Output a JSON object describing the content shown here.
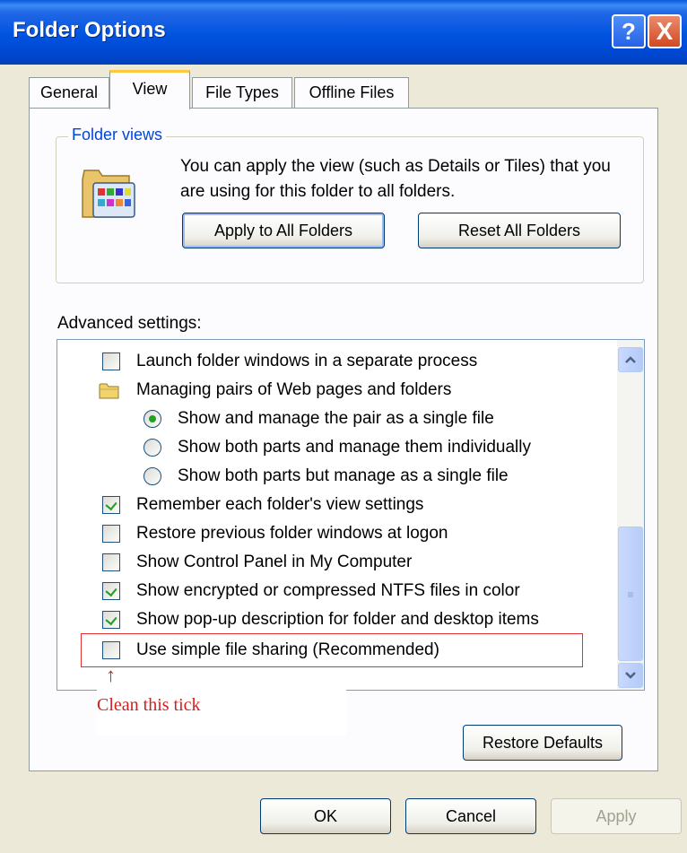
{
  "window": {
    "title": "Folder Options"
  },
  "titlebar": {
    "help_glyph": "?",
    "close_glyph": "X"
  },
  "tabs": [
    {
      "label": "General",
      "active": false
    },
    {
      "label": "View",
      "active": true
    },
    {
      "label": "File Types",
      "active": false
    },
    {
      "label": "Offline Files",
      "active": false
    }
  ],
  "folder_views": {
    "legend": "Folder views",
    "description": "You can apply the view (such as Details or Tiles) that you are using for this folder to all folders.",
    "apply_label": "Apply to All Folders",
    "reset_label": "Reset All Folders"
  },
  "advanced": {
    "label": "Advanced settings:",
    "items": [
      {
        "type": "checkbox",
        "checked": false,
        "label": "Launch folder windows in a separate process"
      },
      {
        "type": "folder",
        "label": "Managing pairs of Web pages and folders"
      },
      {
        "type": "radio",
        "selected": true,
        "label": "Show and manage the pair as a single file"
      },
      {
        "type": "radio",
        "selected": false,
        "label": "Show both parts and manage them individually"
      },
      {
        "type": "radio",
        "selected": false,
        "label": "Show both parts but manage as a single file"
      },
      {
        "type": "checkbox",
        "checked": true,
        "label": "Remember each folder's view settings"
      },
      {
        "type": "checkbox",
        "checked": false,
        "label": "Restore previous folder windows at logon"
      },
      {
        "type": "checkbox",
        "checked": false,
        "label": "Show Control Panel in My Computer"
      },
      {
        "type": "checkbox",
        "checked": true,
        "label": "Show encrypted or compressed NTFS files in color"
      },
      {
        "type": "checkbox",
        "checked": true,
        "label": "Show pop-up description for folder and desktop items"
      },
      {
        "type": "checkbox",
        "checked": false,
        "label": "Use simple file sharing (Recommended)"
      }
    ],
    "restore_label": "Restore Defaults"
  },
  "annotation": {
    "text": "Clean this tick",
    "arrow": "↑"
  },
  "footer": {
    "ok_label": "OK",
    "cancel_label": "Cancel",
    "apply_label": "Apply"
  },
  "colors": {
    "titlebar": "#0053e0",
    "accent": "#ffc83c",
    "check": "#21a121",
    "annotation": "#d02020"
  }
}
